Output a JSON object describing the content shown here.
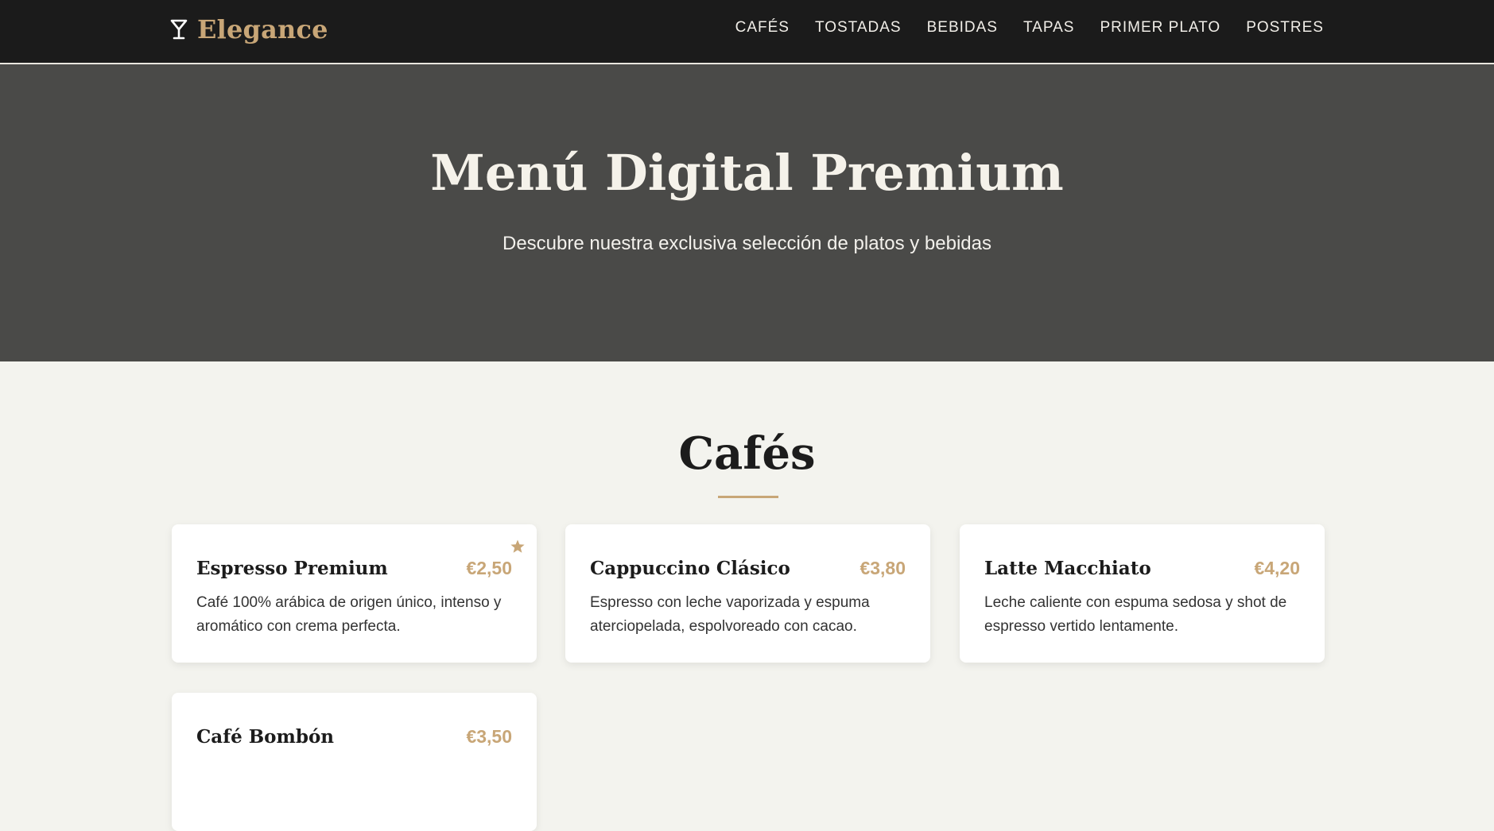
{
  "brand": {
    "name": "Elegance",
    "icon": "cocktail-glass-icon"
  },
  "nav": {
    "items": [
      {
        "label": "CAFÉS"
      },
      {
        "label": "TOSTADAS"
      },
      {
        "label": "BEBIDAS"
      },
      {
        "label": "TAPAS"
      },
      {
        "label": "PRIMER PLATO"
      },
      {
        "label": "POSTRES"
      }
    ]
  },
  "hero": {
    "title": "Menú Digital Premium",
    "subtitle": "Descubre nuestra exclusiva selección de platos y bebidas"
  },
  "section": {
    "title": "Cafés",
    "items": [
      {
        "name": "Espresso Premium",
        "price": "€2,50",
        "description": "Café 100% arábica de origen único, intenso y aromático con crema perfecta.",
        "featured_icon": "star-icon"
      },
      {
        "name": "Cappuccino Clásico",
        "price": "€3,80",
        "description": "Espresso con leche vaporizada y espuma aterciopelada, espolvoreado con cacao."
      },
      {
        "name": "Latte Macchiato",
        "price": "€4,20",
        "description": "Leche caliente con espuma sedosa y shot de espresso vertido lentamente."
      },
      {
        "name": "Café Bombón",
        "price": "€3,50",
        "description": ""
      }
    ]
  },
  "colors": {
    "accent": "#c8a677",
    "nav_bg": "#1b1b1b",
    "hero_bg": "#4a4a48",
    "page_bg": "#f3f3ee"
  }
}
